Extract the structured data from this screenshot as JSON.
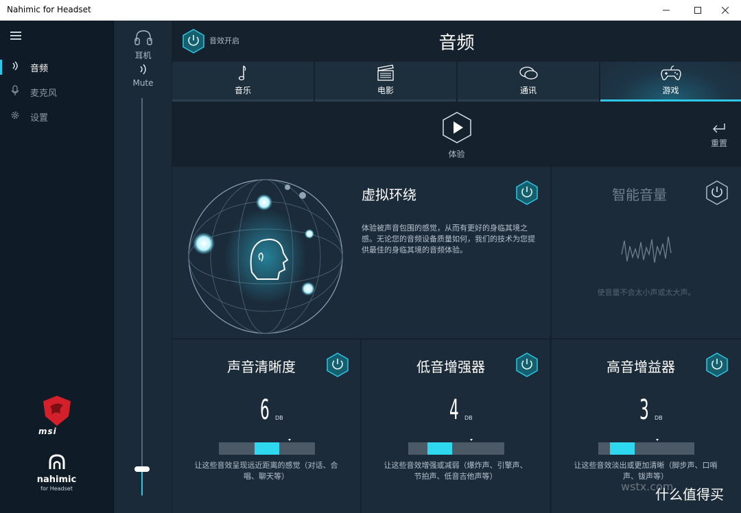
{
  "window": {
    "title": "Nahimic for Headset"
  },
  "sidebar": {
    "items": [
      {
        "label": "音频",
        "icon": "sound-wave-icon",
        "active": true
      },
      {
        "label": "麦克风",
        "icon": "microphone-icon",
        "active": false
      },
      {
        "label": "设置",
        "icon": "gear-icon",
        "active": false
      }
    ],
    "brand_msi": "msi",
    "brand_nahimic": "nahimic",
    "brand_nahimic_sub": "for Headset"
  },
  "device": {
    "headset_label": "耳机",
    "mute_label": "Mute",
    "volume_fraction": 0.07
  },
  "header": {
    "power_label": "音效开启",
    "title": "音频"
  },
  "tabs": [
    {
      "label": "音乐",
      "icon": "music-note-icon",
      "active": false
    },
    {
      "label": "电影",
      "icon": "clapperboard-icon",
      "active": false
    },
    {
      "label": "通讯",
      "icon": "chat-bubble-icon",
      "active": false
    },
    {
      "label": "游戏",
      "icon": "gamepad-icon",
      "active": true
    }
  ],
  "experience_label": "体验",
  "reset_label": "重置",
  "surround": {
    "title": "虚拟环绕",
    "desc": "体验被声音包围的感觉，从而有更好的身临其境之感。无论您的音频设备质量如何，我们的技术为您提供最佳的身临其境的音频体验。"
  },
  "smart_volume": {
    "title": "智能音量",
    "desc": "使音量不会太小声或太大声。"
  },
  "effects": [
    {
      "title": "声音清晰度",
      "value": "6",
      "unit": "DB",
      "fraction": 0.5,
      "desc": "让这些音效呈现远近距离的感觉（对话、合唱、聊天等）"
    },
    {
      "title": "低音增强器",
      "value": "4",
      "unit": "DB",
      "fraction": 0.33,
      "desc": "让这些音效增强或减弱（爆炸声、引擎声、节拍声、低音吉他声等）"
    },
    {
      "title": "高音增益器",
      "value": "3",
      "unit": "DB",
      "fraction": 0.25,
      "desc": "让这些音效淡出或更加清晰（脚步声、口哨声、钹声等）"
    }
  ],
  "watermark": {
    "brand": "什么值得买",
    "site": "wstx.com"
  },
  "colors": {
    "accent": "#2ec7e6",
    "bar_fill": "#2ed8ef",
    "card_bg": "#1b2b3a"
  }
}
